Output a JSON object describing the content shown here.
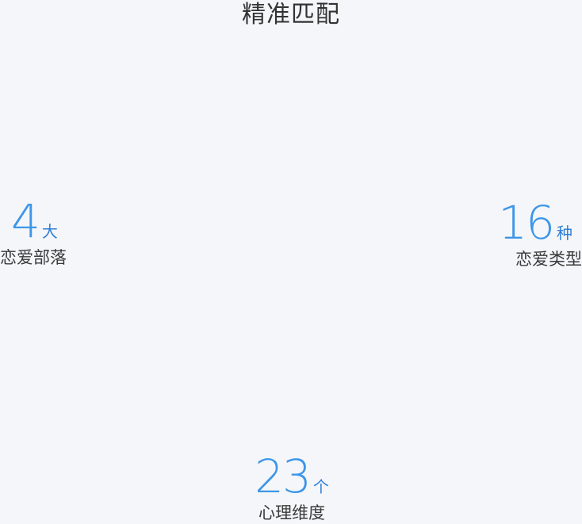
{
  "title": "精准匹配",
  "stats": {
    "left": {
      "number": "4",
      "unit": "大",
      "label": "恋爱部落"
    },
    "right": {
      "number": "16",
      "unit": "种",
      "label": "恋爱类型"
    },
    "bottom": {
      "number": "23",
      "unit": "个",
      "label": "心理维度"
    }
  },
  "colors": {
    "accent": "#3d96e8",
    "text": "#333333",
    "background": "#f4f6f9"
  }
}
